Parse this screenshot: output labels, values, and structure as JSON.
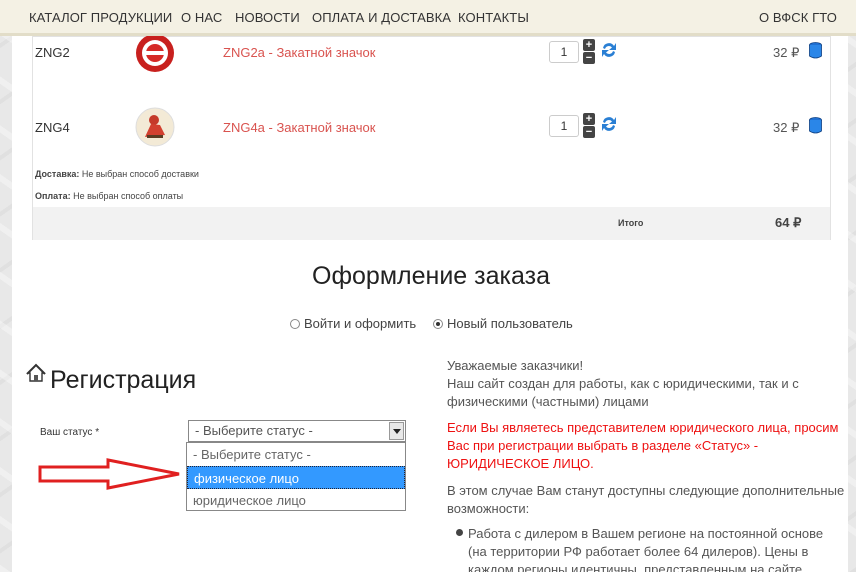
{
  "nav": {
    "catalog": "КАТАЛОГ ПРОДУКЦИИ",
    "about": "О НАС",
    "news": "НОВОСТИ",
    "payment": "ОПЛАТА И ДОСТАВКА",
    "contacts": "КОНТАКТЫ",
    "vfsk": "О ВФСК ГТО"
  },
  "cart": {
    "items": [
      {
        "sku": "ZNG2",
        "name": "ZNG2a - Закатной значок",
        "qty": "1",
        "price": "32 ₽"
      },
      {
        "sku": "ZNG4",
        "name": "ZNG4a - Закатной значок",
        "qty": "1",
        "price": "32 ₽"
      }
    ],
    "delivery_label": "Доставка:",
    "delivery_value": "Не выбран способ доставки",
    "payment_label": "Оплата:",
    "payment_value": "Не выбран способ оплаты",
    "total_label": "Итого",
    "total_value": "64 ₽"
  },
  "checkout": {
    "title": "Оформление заказа",
    "login_option": "Войти и оформить",
    "new_user_option": "Новый пользователь"
  },
  "registration": {
    "title": "Регистрация",
    "status_label": "Ваш статус *",
    "select_value": "- Выберите статус -",
    "options": [
      "- Выберите статус -",
      "физическое лицо",
      "юридическое лицо"
    ]
  },
  "info": {
    "p1_l1": "Уважаемые заказчики!",
    "p1_l2": "Наш сайт создан для работы, как с юридическими, так и с",
    "p1_l3": "физическими (частными) лицами",
    "p2_l1": "Если Вы являетесь представителем юридического лица, просим",
    "p2_l2": "Вас при регистрации выбрать в разделе «Статус» -",
    "p2_l3": "ЮРИДИЧЕСКОЕ ЛИЦО.",
    "p3_l1": "В этом случае Вам станут доступны следующие дополнительные",
    "p3_l2": "возможности:",
    "b1_l1": "Работа с дилером в Вашем регионе на постоянной основе",
    "b1_l2": "(на территории РФ работает более 64 дилеров). Цены в",
    "b1_l3": "каждом регионы идентичны, представленным на сайте."
  },
  "colors": {
    "accent_red": "#e11",
    "link_red": "#d9534f",
    "highlight": "#3399ff",
    "arrow": "#e02020"
  }
}
